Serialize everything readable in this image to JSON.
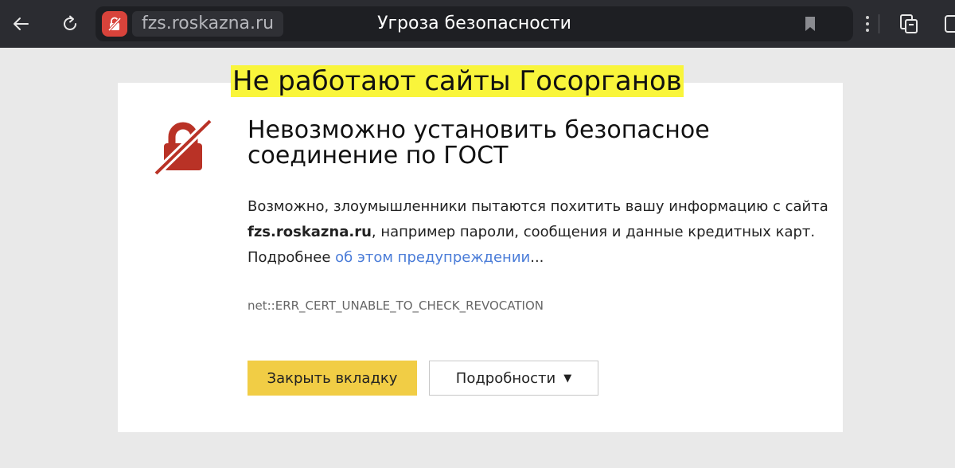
{
  "browser": {
    "domain": "fzs.roskazna.ru",
    "tab_title": "Угроза безопасности",
    "icons": [
      "back-arrow-icon",
      "reload-icon",
      "broken-lock-icon",
      "bookmark-icon",
      "more-menu-icon",
      "extension-icon"
    ]
  },
  "overlay": {
    "headline": "Не работают сайты Госорганов",
    "highlight_color": "#f9f53b"
  },
  "warning": {
    "icon": "broken-lock-icon",
    "icon_color": "#b93226",
    "title_line1": "Невозможно установить безопасное",
    "title_line2": "соединение по ГОСТ",
    "desc_part1": "Возможно, злоумышленники пытаются похитить вашу информацию с сайта",
    "desc_domain": "fzs.roskazna.ru",
    "desc_part2": ", например пароли, сообщения и данные кредитных карт.",
    "more_prefix": "Подробнее ",
    "more_link": "об этом предупреждении",
    "more_suffix": "...",
    "error_code": "net::ERR_CERT_UNABLE_TO_CHECK_REVOCATION"
  },
  "actions": {
    "close_tab": "Закрыть вкладку",
    "details": "Подробности",
    "details_arrow": "▼",
    "primary_color": "#f1cd45"
  }
}
